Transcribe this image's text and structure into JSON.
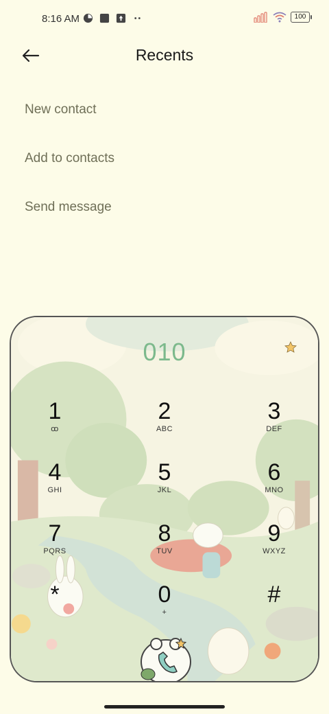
{
  "status": {
    "time": "8:16 AM",
    "battery": "100",
    "icons_left": [
      "app-icon",
      "square-icon",
      "upload-icon",
      "more-dots-icon"
    ],
    "icons_right": [
      "signal-icon",
      "wifi-icon",
      "battery-icon"
    ]
  },
  "header": {
    "title": "Recents",
    "back_icon": "back-arrow-icon"
  },
  "menu": {
    "items": [
      {
        "label": "New contact"
      },
      {
        "label": "Add to contacts"
      },
      {
        "label": "Send message"
      }
    ]
  },
  "dialer": {
    "number": "010",
    "keys": [
      {
        "digit": "1",
        "letters": "ꝏ"
      },
      {
        "digit": "2",
        "letters": "ABC"
      },
      {
        "digit": "3",
        "letters": "DEF"
      },
      {
        "digit": "4",
        "letters": "GHI"
      },
      {
        "digit": "5",
        "letters": "JKL"
      },
      {
        "digit": "6",
        "letters": "MNO"
      },
      {
        "digit": "7",
        "letters": "PQRS"
      },
      {
        "digit": "8",
        "letters": "TUV"
      },
      {
        "digit": "9",
        "letters": "WXYZ"
      },
      {
        "digit": "*",
        "letters": ""
      },
      {
        "digit": "0",
        "letters": "+"
      },
      {
        "digit": "#",
        "letters": ""
      }
    ],
    "call_icon": "phone-icon"
  },
  "colors": {
    "background": "#fdfce8",
    "number": "#7cb98c",
    "menu_text": "#6f6f57"
  }
}
